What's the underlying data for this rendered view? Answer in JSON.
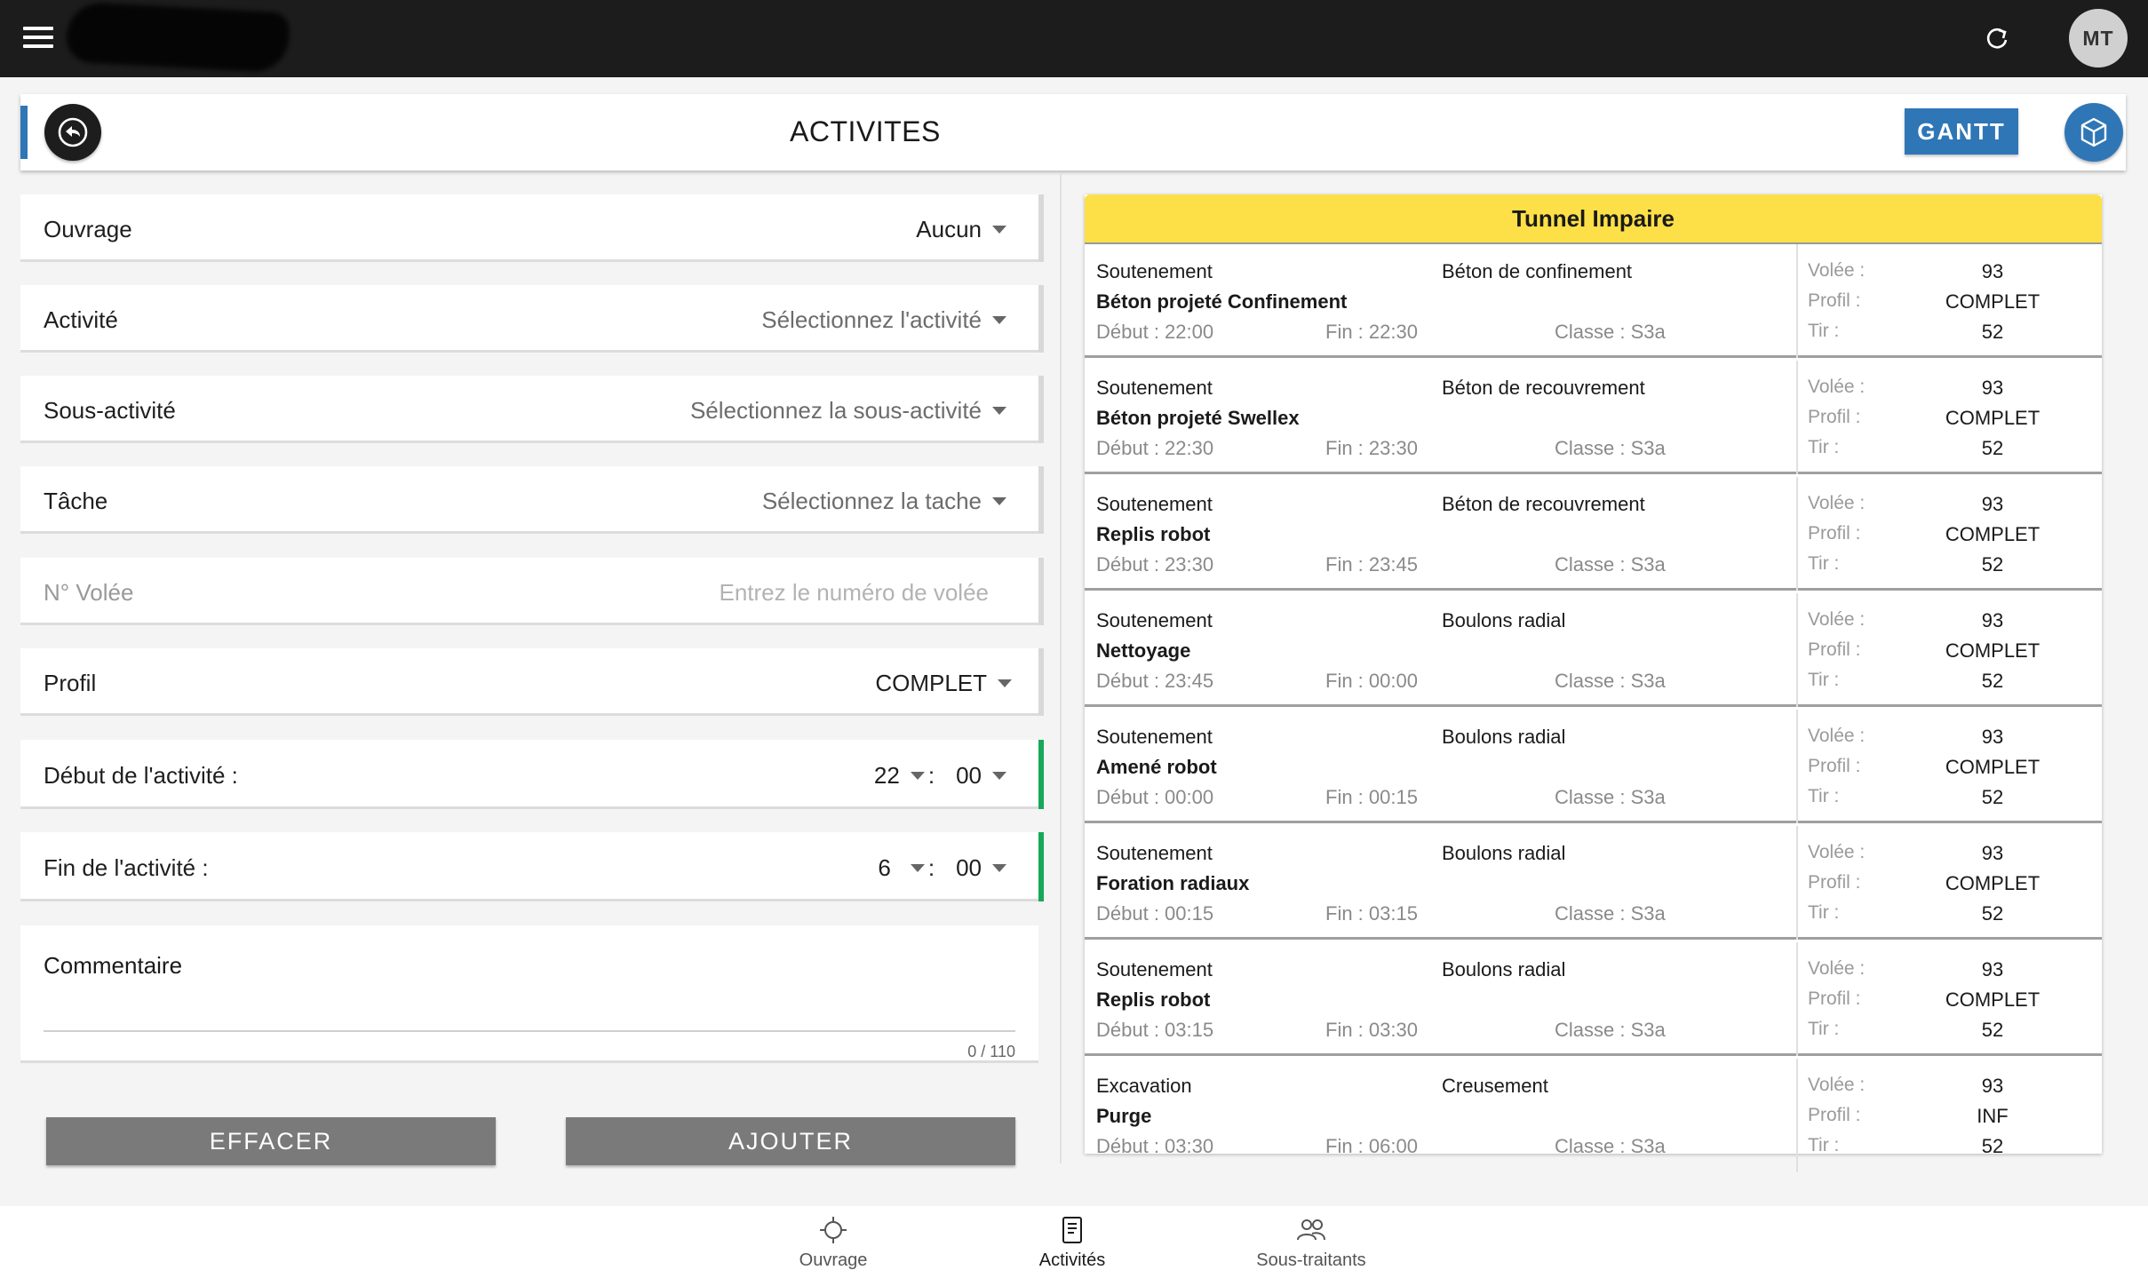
{
  "topbar": {
    "avatar_initials": "MT",
    "icons": [
      "menu-icon",
      "refresh-icon"
    ]
  },
  "header": {
    "title": "ACTIVITES",
    "gantt_label": "GANTT",
    "icons": [
      "back-arrow-icon",
      "cube-icon"
    ],
    "accent_color": "#2f76b6"
  },
  "form": {
    "ouvrage": {
      "label": "Ouvrage",
      "value": "Aucun"
    },
    "activite": {
      "label": "Activité",
      "placeholder": "Sélectionnez l'activité"
    },
    "sous_activite": {
      "label": "Sous-activité",
      "placeholder": "Sélectionnez la sous-activité"
    },
    "tache": {
      "label": "Tâche",
      "placeholder": "Sélectionnez la tache"
    },
    "volee": {
      "label": "N° Volée",
      "placeholder": "Entrez le numéro de volée"
    },
    "profil": {
      "label": "Profil",
      "value": "COMPLET"
    },
    "debut": {
      "label": "Début de l'activité :",
      "hour": "22",
      "sep": ":",
      "minute": "00"
    },
    "fin": {
      "label": "Fin de l'activité :",
      "hour": "6",
      "sep": ":",
      "minute": "00"
    },
    "commentaire": {
      "label": "Commentaire",
      "counter": "0 / 110"
    },
    "clear_label": "EFFACER",
    "add_label": "AJOUTER",
    "valid_color": "#17a85a"
  },
  "list": {
    "title": "Tunnel Impaire",
    "header_color": "#fde047",
    "key_labels": {
      "volee": "Volée :",
      "profil": "Profil :",
      "tir": "Tir :"
    },
    "items": [
      {
        "category": "Soutenement",
        "subcategory": "Béton de confinement",
        "name": "Béton projeté Confinement",
        "debut": "Début : 22:00",
        "fin": "Fin : 22:30",
        "classe": "Classe : S3a",
        "volee": "93",
        "profil": "COMPLET",
        "tir": "52"
      },
      {
        "category": "Soutenement",
        "subcategory": "Béton de recouvrement",
        "name": "Béton projeté Swellex",
        "debut": "Début : 22:30",
        "fin": "Fin : 23:30",
        "classe": "Classe : S3a",
        "volee": "93",
        "profil": "COMPLET",
        "tir": "52"
      },
      {
        "category": "Soutenement",
        "subcategory": "Béton de recouvrement",
        "name": "Replis robot",
        "debut": "Début : 23:30",
        "fin": "Fin : 23:45",
        "classe": "Classe : S3a",
        "volee": "93",
        "profil": "COMPLET",
        "tir": "52"
      },
      {
        "category": "Soutenement",
        "subcategory": "Boulons radial",
        "name": "Nettoyage",
        "debut": "Début : 23:45",
        "fin": "Fin : 00:00",
        "classe": "Classe : S3a",
        "volee": "93",
        "profil": "COMPLET",
        "tir": "52"
      },
      {
        "category": "Soutenement",
        "subcategory": "Boulons radial",
        "name": "Amené robot",
        "debut": "Début : 00:00",
        "fin": "Fin : 00:15",
        "classe": "Classe : S3a",
        "volee": "93",
        "profil": "COMPLET",
        "tir": "52"
      },
      {
        "category": "Soutenement",
        "subcategory": "Boulons radial",
        "name": "Foration radiaux",
        "debut": "Début : 00:15",
        "fin": "Fin : 03:15",
        "classe": "Classe : S3a",
        "volee": "93",
        "profil": "COMPLET",
        "tir": "52"
      },
      {
        "category": "Soutenement",
        "subcategory": "Boulons radial",
        "name": "Replis robot",
        "debut": "Début : 03:15",
        "fin": "Fin : 03:30",
        "classe": "Classe : S3a",
        "volee": "93",
        "profil": "COMPLET",
        "tir": "52"
      },
      {
        "category": "Excavation",
        "subcategory": "Creusement",
        "name": "Purge",
        "debut": "Début : 03:30",
        "fin": "Fin : 06:00",
        "classe": "Classe : S3a",
        "volee": "93",
        "profil": "INF",
        "tir": "52"
      }
    ]
  },
  "bottomnav": {
    "items": [
      {
        "label": "Ouvrage",
        "icon": "crosshair-icon"
      },
      {
        "label": "Activités",
        "icon": "document-icon"
      },
      {
        "label": "Sous-traitants",
        "icon": "people-icon"
      }
    ],
    "active": "Activités"
  }
}
